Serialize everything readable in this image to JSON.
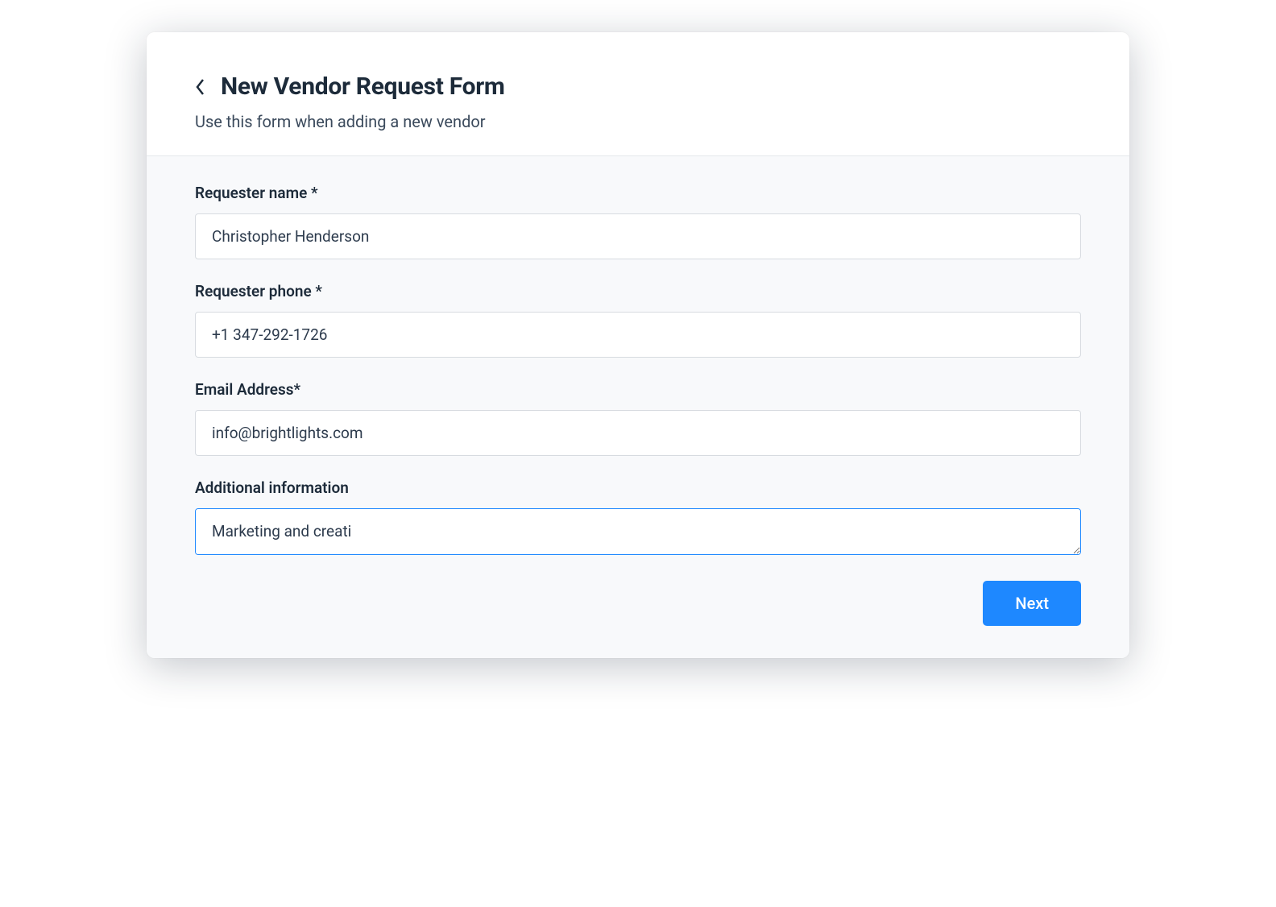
{
  "header": {
    "title": "New Vendor Request Form",
    "subtitle": "Use this form when adding a new vendor"
  },
  "form": {
    "fields": {
      "requester_name": {
        "label": "Requester name *",
        "value": "Christopher Henderson"
      },
      "requester_phone": {
        "label": "Requester phone *",
        "value": "+1 347-292-1726"
      },
      "email": {
        "label": "Email Address*",
        "value": "info@brightlights.com"
      },
      "additional_info": {
        "label": "Additional information",
        "value": "Marketing and creati"
      }
    }
  },
  "buttons": {
    "next": "Next"
  }
}
